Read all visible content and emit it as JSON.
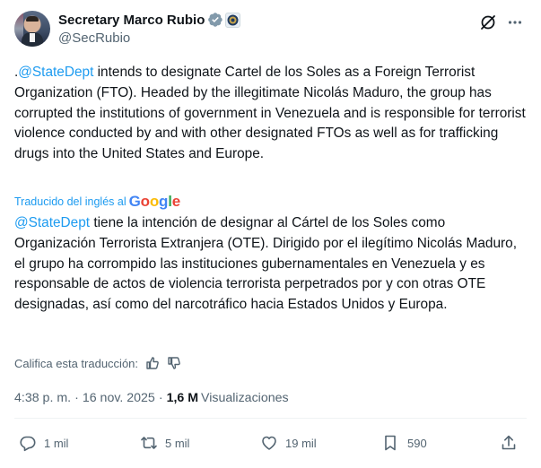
{
  "author": {
    "display_name": "Secretary Marco Rubio",
    "handle": "@SecRubio",
    "avatar_icon": "profile-photo"
  },
  "colors": {
    "link": "#1d9bf0",
    "secondary_text": "#536471",
    "primary_text": "#0f1419",
    "verified": "#829aab"
  },
  "tweet": {
    "prefix": ".",
    "mention": "@StateDept",
    "body": " intends to designate Cartel de los Soles as a Foreign Terrorist Organization (FTO). Headed by the illegitimate Nicolás Maduro, the group has corrupted the institutions of government in Venezuela and is responsible for terrorist violence conducted by and with other designated FTOs as well as for trafficking drugs into the United States and Europe."
  },
  "translation": {
    "label": "Traducido del inglés al",
    "provider": "Google",
    "mention": "@StateDept",
    "body": " tiene la intención de designar al Cártel de los Soles como Organización Terrorista Extranjera (OTE). Dirigido por el ilegítimo Nicolás Maduro, el grupo ha corrompido las instituciones gubernamentales en Venezuela y es responsable de actos de violencia terrorista perpetrados por y con otras OTE designadas, así como del narcotráfico hacia Estados Unidos y Europa.",
    "rate_label": "Califica esta traducción:"
  },
  "meta": {
    "time": "4:38 p. m.",
    "separator": "·",
    "date": "16 nov. 2025",
    "views_count": "1,6 M",
    "views_label": "Visualizaciones"
  },
  "actions": {
    "replies": "1 mil",
    "reposts": "5 mil",
    "likes": "19 mil",
    "bookmarks": "590"
  }
}
